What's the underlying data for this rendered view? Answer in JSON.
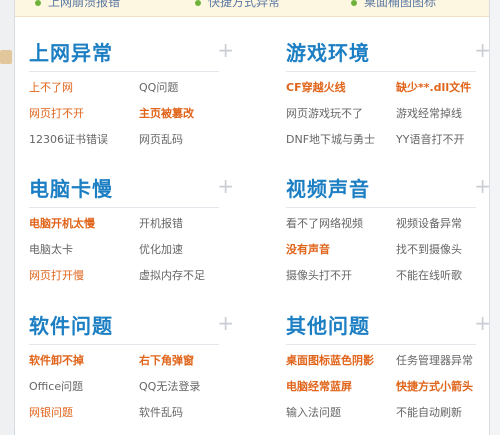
{
  "top_strip": {
    "items": [
      "上网崩溃报错",
      "快捷方式异常",
      "桌面桶图图标"
    ]
  },
  "sections": [
    {
      "title": "上网异常",
      "links": [
        {
          "text": "上不了网",
          "color": "orange",
          "bold": false
        },
        {
          "text": "QQ问题",
          "color": "gray",
          "bold": false
        },
        {
          "text": "网页打不开",
          "color": "orange",
          "bold": false
        },
        {
          "text": "主页被篡改",
          "color": "orange",
          "bold": true
        },
        {
          "text": "12306证书错误",
          "color": "gray",
          "bold": false
        },
        {
          "text": "网页乱码",
          "color": "gray",
          "bold": false
        }
      ]
    },
    {
      "title": "游戏环境",
      "links": [
        {
          "text": "CF穿越火线",
          "color": "orange",
          "bold": true
        },
        {
          "text": "缺少**.dll文件",
          "color": "orange",
          "bold": true
        },
        {
          "text": "网页游戏玩不了",
          "color": "gray",
          "bold": false
        },
        {
          "text": "游戏经常掉线",
          "color": "gray",
          "bold": false
        },
        {
          "text": "DNF地下城与勇士",
          "color": "gray",
          "bold": false
        },
        {
          "text": "YY语音打不开",
          "color": "gray",
          "bold": false
        }
      ]
    },
    {
      "title": "电脑卡慢",
      "links": [
        {
          "text": "电脑开机太慢",
          "color": "orange",
          "bold": true
        },
        {
          "text": "开机报错",
          "color": "gray",
          "bold": false
        },
        {
          "text": "电脑太卡",
          "color": "gray",
          "bold": false
        },
        {
          "text": "优化加速",
          "color": "gray",
          "bold": false
        },
        {
          "text": "网页打开慢",
          "color": "orange",
          "bold": false
        },
        {
          "text": "虚拟内存不足",
          "color": "gray",
          "bold": false
        }
      ]
    },
    {
      "title": "视频声音",
      "links": [
        {
          "text": "看不了网络视频",
          "color": "gray",
          "bold": false
        },
        {
          "text": "视频设备异常",
          "color": "gray",
          "bold": false
        },
        {
          "text": "没有声音",
          "color": "orange",
          "bold": true
        },
        {
          "text": "找不到摄像头",
          "color": "gray",
          "bold": false
        },
        {
          "text": "摄像头打不开",
          "color": "gray",
          "bold": false
        },
        {
          "text": "不能在线听歌",
          "color": "gray",
          "bold": false
        }
      ]
    },
    {
      "title": "软件问题",
      "links": [
        {
          "text": "软件卸不掉",
          "color": "orange",
          "bold": true
        },
        {
          "text": "右下角弹窗",
          "color": "orange",
          "bold": true
        },
        {
          "text": "Office问题",
          "color": "gray",
          "bold": false
        },
        {
          "text": "QQ无法登录",
          "color": "gray",
          "bold": false
        },
        {
          "text": "网银问题",
          "color": "orange",
          "bold": false
        },
        {
          "text": "软件乱码",
          "color": "gray",
          "bold": false
        }
      ]
    },
    {
      "title": "其他问题",
      "links": [
        {
          "text": "桌面图标蓝色阴影",
          "color": "orange",
          "bold": true
        },
        {
          "text": "任务管理器异常",
          "color": "gray",
          "bold": false
        },
        {
          "text": "电脑经常蓝屏",
          "color": "orange",
          "bold": true
        },
        {
          "text": "快捷方式小箭头",
          "color": "orange",
          "bold": true
        },
        {
          "text": "输入法问题",
          "color": "gray",
          "bold": false
        },
        {
          "text": "不能自动刷新",
          "color": "gray",
          "bold": false
        }
      ]
    }
  ],
  "colors": {
    "title_blue": "#1d7fc3",
    "link_orange": "#e0641a",
    "link_gray": "#666666",
    "plus_gray": "#c9ced4"
  }
}
